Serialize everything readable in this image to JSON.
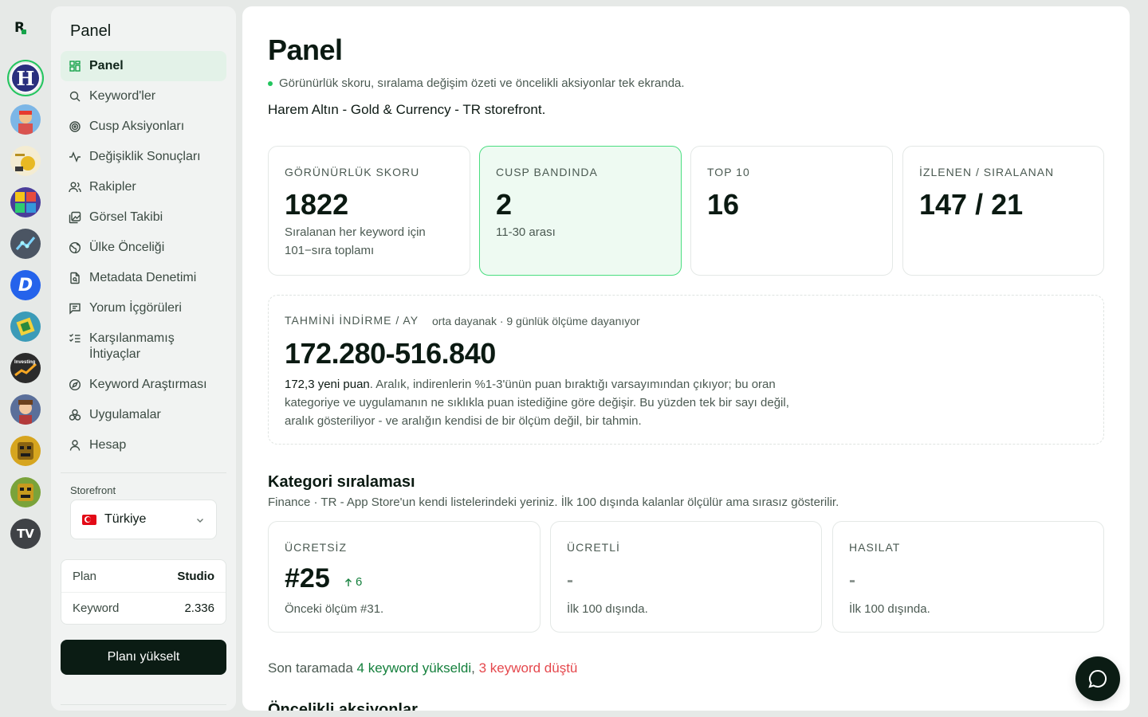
{
  "rail": {
    "apps": [
      {
        "name": "Harem Altın",
        "glyph": "H",
        "bg": "#2a2f7e",
        "active": true
      },
      {
        "name": "Subway Surfers",
        "glyph": "",
        "bg": "#6fa7d8"
      },
      {
        "name": "Altın",
        "glyph": "",
        "bg": "#e9d27a"
      },
      {
        "name": "Block Puzzle",
        "glyph": "",
        "bg": "#5b4aa8"
      },
      {
        "name": "Chart App",
        "glyph": "",
        "bg": "#4b5563"
      },
      {
        "name": "D App",
        "glyph": "D",
        "bg": "#2563eb"
      },
      {
        "name": "Geometry",
        "glyph": "",
        "bg": "#3b9bb8"
      },
      {
        "name": "Investing",
        "glyph": "Investing",
        "bg": "#2b2b2b"
      },
      {
        "name": "Hero Game",
        "glyph": "",
        "bg": "#5a6f9a"
      },
      {
        "name": "Temple Run",
        "glyph": "",
        "bg": "#c79a1e"
      },
      {
        "name": "Temple Run 2",
        "glyph": "",
        "bg": "#7aa33a"
      },
      {
        "name": "TradingView",
        "glyph": "TV",
        "bg": "#3f4246"
      }
    ]
  },
  "sidebar": {
    "title": "Panel",
    "items": [
      {
        "label": "Panel",
        "icon": "dashboard-icon",
        "active": true
      },
      {
        "label": "Keyword'ler",
        "icon": "search-icon"
      },
      {
        "label": "Cusp Aksiyonları",
        "icon": "target-icon"
      },
      {
        "label": "Değişiklik Sonuçları",
        "icon": "activity-icon"
      },
      {
        "label": "Rakipler",
        "icon": "users-icon"
      },
      {
        "label": "Görsel Takibi",
        "icon": "images-icon"
      },
      {
        "label": "Ülke Önceliği",
        "icon": "globe-icon"
      },
      {
        "label": "Metadata Denetimi",
        "icon": "file-search-icon"
      },
      {
        "label": "Yorum İçgörüleri",
        "icon": "message-icon"
      },
      {
        "label": "Karşılanmamış İhtiyaçlar",
        "icon": "list-checks-icon"
      },
      {
        "label": "Keyword Araştırması",
        "icon": "compass-icon"
      },
      {
        "label": "Uygulamalar",
        "icon": "apps-icon"
      },
      {
        "label": "Hesap",
        "icon": "user-icon"
      }
    ],
    "storefront_label": "Storefront",
    "storefront_value": "Türkiye",
    "plan_label": "Plan",
    "plan_value": "Studio",
    "keyword_label": "Keyword",
    "keyword_value": "2.336",
    "upgrade_label": "Planı yükselt"
  },
  "main": {
    "title": "Panel",
    "subtitle": "Görünürlük skoru, sıralama değişim özeti ve öncelikli aksiyonlar tek ekranda.",
    "app_line": "Harem Altın - Gold & Currency - TR storefront.",
    "stats": [
      {
        "label": "GÖRÜNÜRLÜK SKORU",
        "value": "1822",
        "note": "Sıralanan her keyword için 101−sıra toplamı"
      },
      {
        "label": "CUSP BANDINDA",
        "value": "2",
        "note": "11-30 arası"
      },
      {
        "label": "TOP 10",
        "value": "16",
        "note": ""
      },
      {
        "label": "İZLENEN / SIRALANAN",
        "value": "147 / 21",
        "note": ""
      }
    ],
    "estimate": {
      "label": "TAHMİNİ İNDİRME / AY",
      "note": "orta dayanak · 9 günlük ölçüme dayanıyor",
      "value": "172.280-516.840",
      "rating_strong": "172,3 yeni puan",
      "rating_text": ". Aralık, indirenlerin %1-3'ünün puan bıraktığı varsayımından çıkıyor; bu oran kategoriye ve uygulamanın ne sıklıkla puan istediğine göre değişir. Bu yüzden tek bir sayı değil, aralık gösteriliyor - ve aralığın kendisi de bir ölçüm değil, bir tahmin."
    },
    "category": {
      "title": "Kategori sıralaması",
      "subtitle": "Finance · TR - App Store'un kendi listelerindeki yeriniz. İlk 100 dışında kalanlar ölçülür ama sırasız gösterilir.",
      "cards": [
        {
          "label": "ÜCRETSİZ",
          "value": "#25",
          "delta": "6",
          "note": "Önceki ölçüm #31."
        },
        {
          "label": "ÜCRETLİ",
          "value": "-",
          "note": "İlk 100 dışında."
        },
        {
          "label": "HASILAT",
          "value": "-",
          "note": "İlk 100 dışında."
        }
      ]
    },
    "scan": {
      "prefix": "Son taramada ",
      "up": "4 keyword yükseldi",
      "sep": ", ",
      "down": "3 keyword düştü"
    },
    "next_title": "Öncelikli aksiyonlar"
  },
  "colors": {
    "accent": "#16a34a",
    "dark": "#0b1c14",
    "down": "#e5484d"
  }
}
